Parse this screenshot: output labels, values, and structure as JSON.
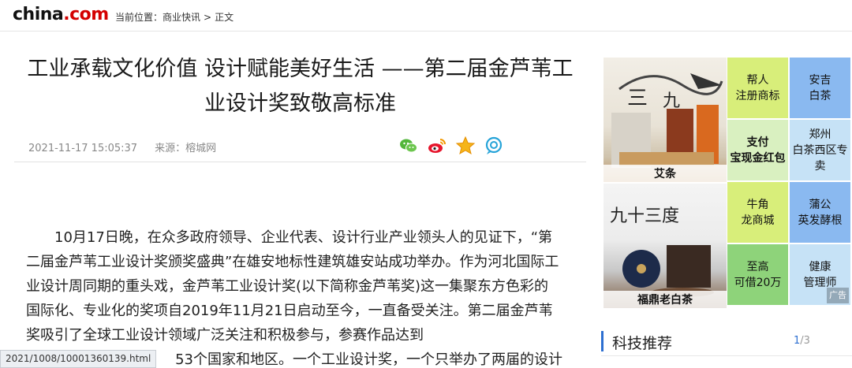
{
  "header": {
    "logo": {
      "main": "china",
      "dot": ".com"
    },
    "breadcrumb": {
      "prefix": "当前位置：",
      "items": [
        "商业快讯",
        "正文"
      ],
      "separator": ">"
    }
  },
  "article": {
    "title_line1": "工业承载文化价值 设计赋能美好生活 ——第二届金芦苇工",
    "title_line2": "业设计奖致敬高标准",
    "datetime": "2021-11-17 15:05:37",
    "source": "来源：榕城网",
    "share_icons": [
      "wechat-icon",
      "weibo-icon",
      "favorite-star-icon",
      "comment-icon"
    ],
    "paragraph": "10月17日晚，在众多政府领导、企业代表、设计行业产业领头人的见证下，“第二届金芦苇工业设计奖颁奖盛典”在雄安地标性建筑雄安站成功举办。作为河北国际工业设计周同期的重头戏，金芦苇工业设计奖(以下简称金芦苇奖)这一集聚东方色彩的国际化、专业化的奖项自2019年11月21日启动至今，一直备受关注。第二届金芦苇奖吸引了全球工业设计领域广泛关注和积极参与，参赛作品达到",
    "paragraph_tail": "53个国家和地区。一个工业设计奖，一个只举办了两届的设计"
  },
  "status_bar": {
    "url": "2021/1008/10001360139.html"
  },
  "ads": {
    "image_ads": [
      {
        "caption": "艾条"
      },
      {
        "caption": "福鼎老白茶",
        "overlay_text": "九十三度"
      }
    ],
    "tiles": [
      {
        "lines": [
          "帮人",
          "注册商标"
        ],
        "color": "yg"
      },
      {
        "lines": [
          "安吉",
          "白茶"
        ],
        "color": "bl"
      },
      {
        "lines": [
          "支付",
          "宝现金红包"
        ],
        "color": "mg",
        "bold": true
      },
      {
        "lines": [
          "郑州",
          "白茶西区专卖"
        ],
        "color": "lb"
      },
      {
        "lines": [
          "牛角",
          "龙商城"
        ],
        "color": "yg"
      },
      {
        "lines": [
          "蒲公",
          "英发酵根"
        ],
        "color": "bl"
      },
      {
        "lines": [
          "至高",
          "可借20万"
        ],
        "color": "gr"
      },
      {
        "lines": [
          "健康",
          "管理师"
        ],
        "color": "lb"
      }
    ],
    "ad_label": "广告"
  },
  "sidebar": {
    "recommend_title": "科技推荐",
    "page_current": "1",
    "page_total": "3",
    "page_separator": "/"
  },
  "colors": {
    "accent_blue": "#2d6fd1",
    "logo_red": "#d40000",
    "tile_yellow_green": "#d8ee7a",
    "tile_blue": "#8ab9f0"
  }
}
